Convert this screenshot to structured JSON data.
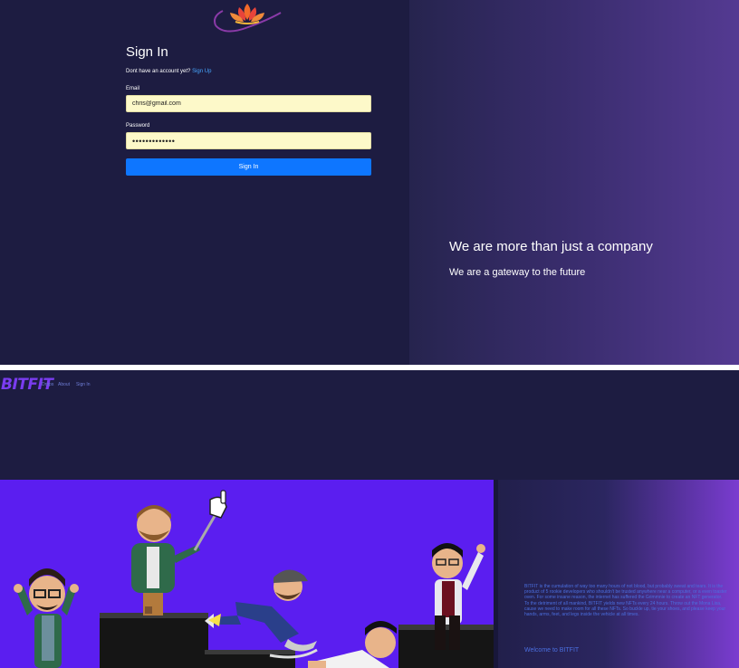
{
  "signin": {
    "title": "Sign In",
    "no_account_text": "Dont have an account yet?",
    "signup_link": "Sign Up",
    "email_label": "Email",
    "email_value": "chris@gmail.com",
    "password_label": "Password",
    "password_value": "•••••••••••••",
    "button_label": "Sign In"
  },
  "hero": {
    "heading": "We are more than just a company",
    "subheading": "We are a gateway to the future"
  },
  "landing": {
    "brand": "BITFIT",
    "nav": [
      "Drops",
      "About",
      "Sign In"
    ],
    "about_text": "BITFIT is the cumulation of way too many hours of not blood, but probably sweat and tears. It is the product of 5 rookie developers who shouldn't be trusted anywhere near a computer, or a even toaster oven. For some insane reason, the internet has suffered the Grimmnie to create an NFT generator. To the detriment of all mankind, BITFIT yields new NFTs every 24 hours. Throw out the Mona Lisa, cause we need to make room for all these NFTs. So buckle up, tie your shoes, and please keep your hands, arms, feet, and legs inside the vehicle at all times.",
    "welcome": "Welcome to BITFIT"
  },
  "colors": {
    "signin_bg": "#1d1c41",
    "button_blue": "#0e76ff",
    "input_bg": "#fdf9c9",
    "link_blue": "#47a6ff",
    "art_bg": "#5b1ef0",
    "brand_purple": "#7a3cf0"
  },
  "icons": {
    "logo": "lotus-logo-icon",
    "art": "cartoon-avatars-illustration"
  }
}
